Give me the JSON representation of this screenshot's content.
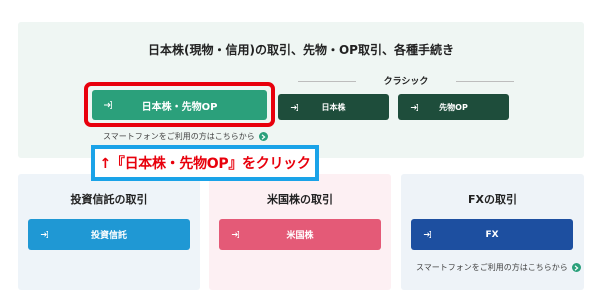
{
  "top_section": {
    "title": "日本株(現物・信用)の取引、先物・OP取引、各種手続き",
    "classic_label": "クラシック",
    "main_button": "日本株・先物OP",
    "classic_buttons": [
      "日本株",
      "先物OP"
    ],
    "smartphone_link": "スマートフォンをご利用の方はこちらから"
  },
  "callout": {
    "text": "↑『日本株・先物OP』をクリック"
  },
  "cards": {
    "invest": {
      "title": "投資信託の取引",
      "button": "投資信託"
    },
    "us": {
      "title": "米国株の取引",
      "button": "米国株"
    },
    "fx": {
      "title": "FXの取引",
      "button": "FX",
      "smartphone_link": "スマートフォンをご利用の方はこちらから"
    }
  },
  "colors": {
    "green_main": "#2ba07b",
    "green_dark": "#1e4d3b",
    "highlight_red": "#e8000c",
    "callout_blue": "#1aa3e8",
    "invest_blue": "#1f98d4",
    "us_pink": "#e45a77",
    "fx_navy": "#1d4fa0"
  },
  "icons": {
    "button_arrow": "login-arrow-icon",
    "link_arrow": "chevron-right-circle-icon"
  }
}
